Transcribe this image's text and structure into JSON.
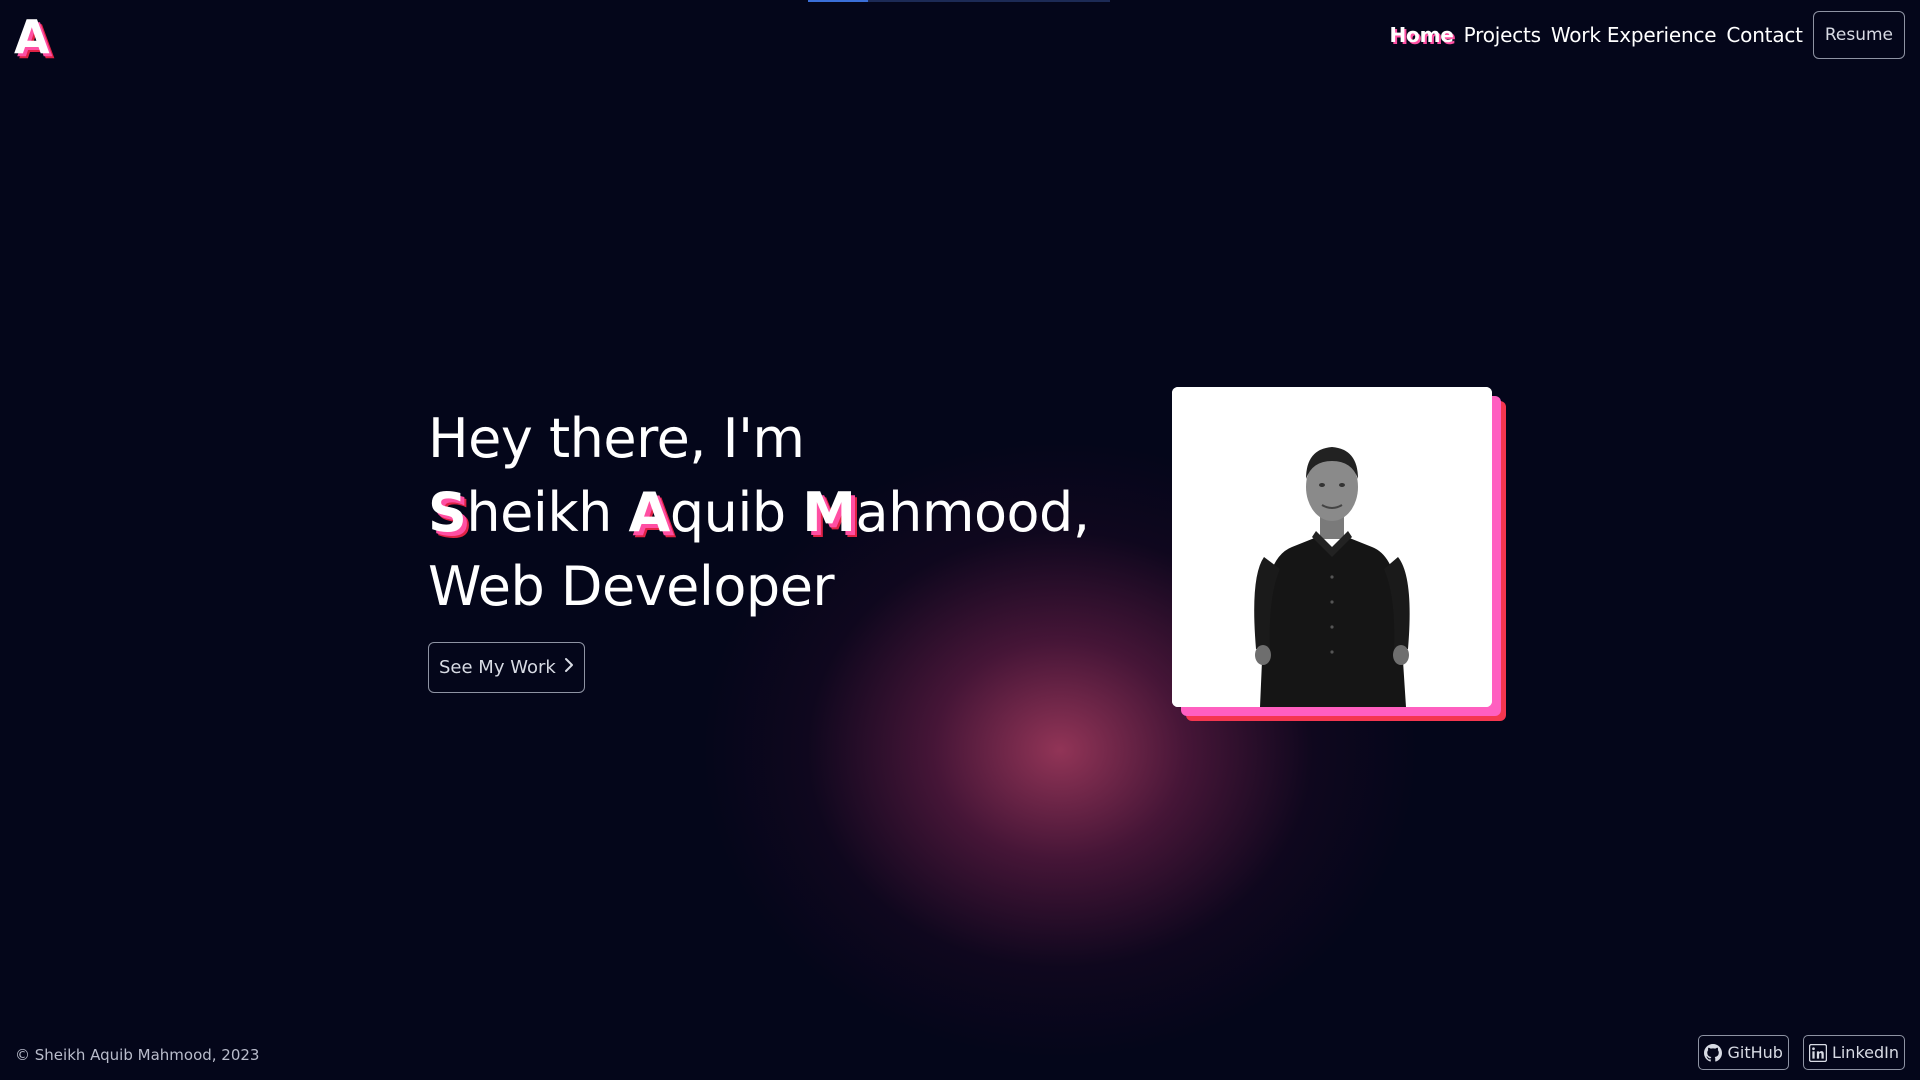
{
  "brand": {
    "logo_letter": "A"
  },
  "top_progress": {
    "fraction": 0.2
  },
  "nav": {
    "items": [
      {
        "label": "Home",
        "active": true
      },
      {
        "label": "Projects",
        "active": false
      },
      {
        "label": "Work Experience",
        "active": false
      },
      {
        "label": "Contact",
        "active": false
      }
    ],
    "resume_label": "Resume"
  },
  "hero": {
    "greeting": "Hey there, I'm",
    "name_parts": [
      {
        "initial": "S",
        "rest": "heikh"
      },
      {
        "initial": "A",
        "rest": "quib"
      },
      {
        "initial": "M",
        "rest": "ahmood,"
      }
    ],
    "role": "Web Developer",
    "cta_label": "See My Work",
    "cta_icon": "chevron-right-icon"
  },
  "footer": {
    "copyright": "© Sheikh Aquib Mahmood, 2023",
    "social": [
      {
        "label": "GitHub",
        "icon": "github-icon"
      },
      {
        "label": "LinkedIn",
        "icon": "linkedin-icon"
      }
    ]
  },
  "colors": {
    "background": "#04061a",
    "accent_pink": "#ff4fa3",
    "accent_red": "#e02245",
    "glow": "#c8466e"
  }
}
